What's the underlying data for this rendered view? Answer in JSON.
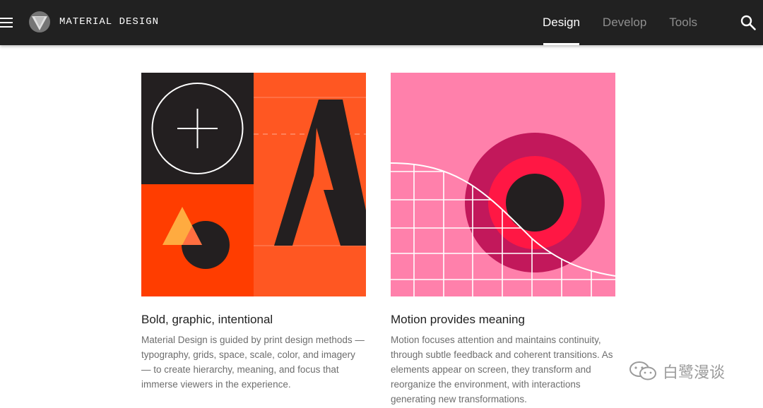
{
  "header": {
    "brand": "MATERIAL DESIGN",
    "tabs": [
      {
        "label": "Design",
        "active": true
      },
      {
        "label": "Develop",
        "active": false
      },
      {
        "label": "Tools",
        "active": false
      }
    ],
    "icons": {
      "menu": "menu-icon",
      "logo": "material-logo-icon",
      "search": "search-icon"
    }
  },
  "cards": [
    {
      "title": "Bold, graphic, intentional",
      "body": "Material Design is guided by print design methods — typography, grids, space, scale, color, and imagery — to create hierarchy, meaning, and focus that immerse viewers in the experience."
    },
    {
      "title": "Motion provides meaning",
      "body": "Motion focuses attention and maintains continuity, through subtle feedback and coherent transitions. As elements appear on screen, they transform and reorganize the environment, with interactions generating new transformations."
    }
  ],
  "watermark": {
    "text": "白鹭漫谈",
    "icon": "wechat-icon"
  },
  "colors": {
    "topbar": "#212121",
    "orange": "#ff5722",
    "deep_orange": "#ff3d00",
    "dark": "#231f20",
    "pink": "#ff80ab",
    "magenta": "#c2185b",
    "red": "#ff1744",
    "amber": "#ffab40"
  }
}
